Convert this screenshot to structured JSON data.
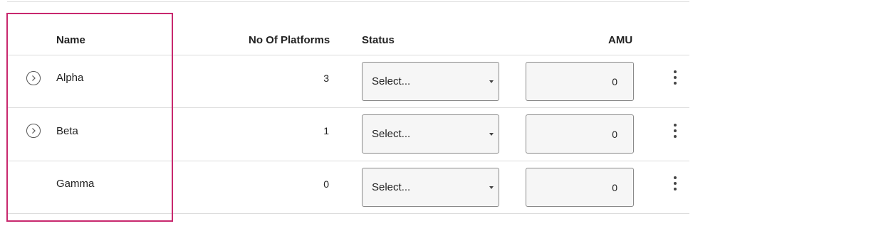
{
  "table": {
    "headers": {
      "name": "Name",
      "platforms": "No Of Platforms",
      "status": "Status",
      "amu": "AMU"
    },
    "rows": [
      {
        "name": "Alpha",
        "platforms": "3",
        "status": "Select...",
        "amu": "0",
        "expandable": true
      },
      {
        "name": "Beta",
        "platforms": "1",
        "status": "Select...",
        "amu": "0",
        "expandable": true
      },
      {
        "name": "Gamma",
        "platforms": "0",
        "status": "Select...",
        "amu": "0",
        "expandable": false
      }
    ]
  },
  "colors": {
    "highlight_border": "#c8286e",
    "divider": "#dcdcdc",
    "input_bg": "#f6f6f6"
  },
  "icons": {
    "expand": "chevron-right-circle-icon",
    "dropdown": "caret-down-icon",
    "more": "vertical-ellipsis-icon"
  }
}
